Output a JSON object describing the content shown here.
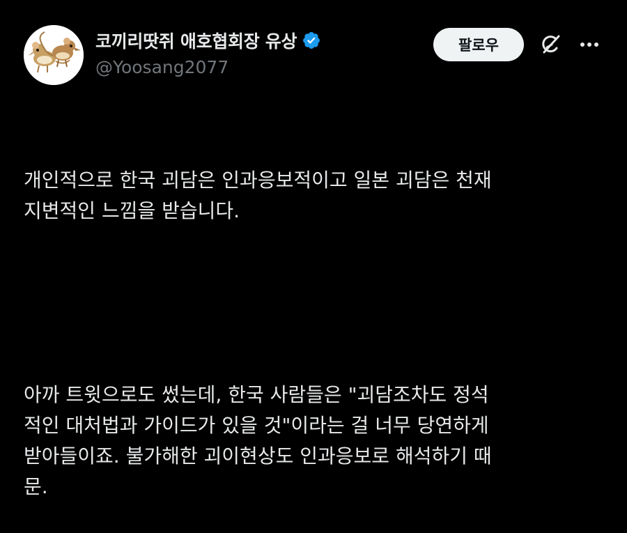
{
  "post": {
    "author": {
      "display_name": "코끼리땃쥐 애호협회장 유상",
      "handle": "@Yoosang2077",
      "verified": true,
      "verified_icon": "verified-badge-icon",
      "avatar_icon": "elephant-shrew-avatar"
    },
    "actions": {
      "follow_label": "팔로우",
      "grok_icon": "grok-icon",
      "more_icon": "more-icon"
    },
    "paragraphs": [
      "개인적으로 한국 괴담은 인과응보적이고 일본 괴담은 천재\n지변적인 느낌을 받습니다.",
      "아까 트윗으로도 썼는데, 한국 사람들은 \"괴담조차도 정석\n적인 대처법과 가이드가 있을 것\"이라는 걸 너무 당연하게\n받아들이죠. 불가해한 괴이현상도 인과응보로 해석하기 때\n문."
    ]
  },
  "colors": {
    "background": "#000000",
    "text_primary": "#e7e9ea",
    "text_secondary": "#71767b",
    "verified_blue": "#1d9bf0",
    "button_bg": "#eff3f4",
    "button_text": "#0f1419"
  }
}
